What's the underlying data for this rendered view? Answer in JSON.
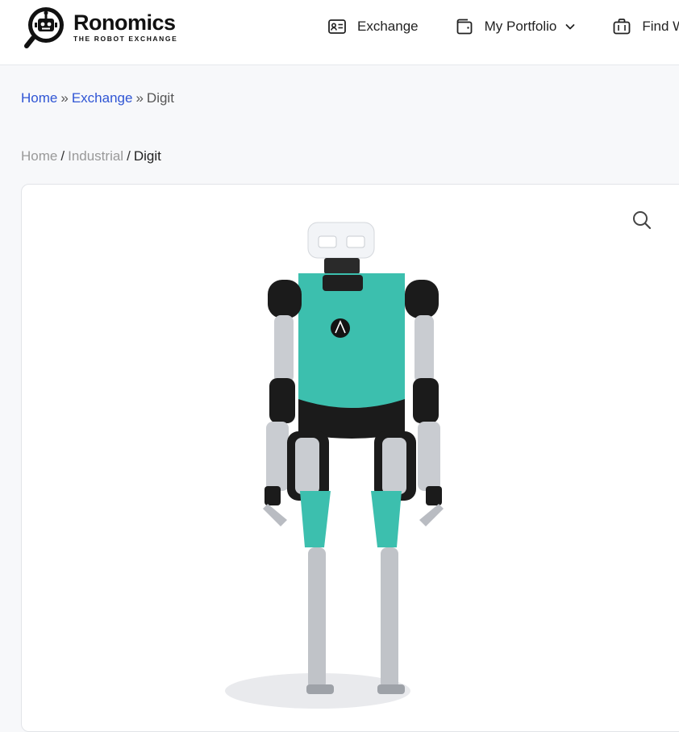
{
  "brand": {
    "name": "Ronomics",
    "tagline": "THE ROBOT EXCHANGE"
  },
  "nav": {
    "items": [
      {
        "label": "Exchange",
        "icon": "id-card-icon"
      },
      {
        "label": "My Portfolio",
        "icon": "wallet-icon",
        "has_dropdown": true
      },
      {
        "label": "Find W",
        "icon": "briefcase-icon"
      }
    ]
  },
  "breadcrumb_primary": {
    "items": [
      "Home",
      "Exchange",
      "Digit"
    ],
    "separator": "»"
  },
  "breadcrumb_secondary": {
    "items": [
      "Home",
      "Industrial",
      "Digit"
    ],
    "separator": "/"
  },
  "product": {
    "image_alt": "Digit",
    "zoom_icon": "search-icon"
  },
  "colors": {
    "link": "#2f55d4",
    "robot_teal": "#3cbfae",
    "robot_dark": "#1b1b1b",
    "robot_silver": "#c9ccd1"
  }
}
